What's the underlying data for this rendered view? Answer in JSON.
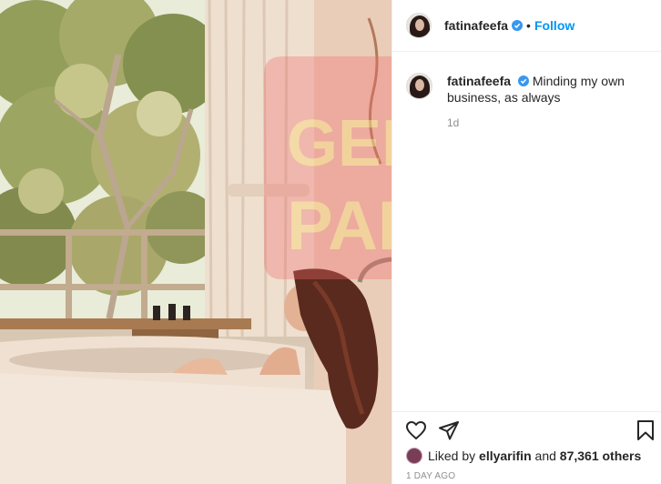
{
  "post": {
    "username": "fatinafeefa",
    "separator": "•",
    "follow_label": "Follow"
  },
  "caption": {
    "username": "fatinafeefa",
    "text": "Minding my own business, as always",
    "time": "1d"
  },
  "likes": {
    "prefix": "Liked by",
    "user": "ellyarifin",
    "connector": "and",
    "others": "87,361 others"
  },
  "date": "1 DAY AGO",
  "watermark": {
    "line1": "GEM",
    "line2": "PAK"
  },
  "colors": {
    "link": "#0095f6",
    "verified": "#3897f0",
    "watermark_red": "#f26b6b",
    "watermark_yellow": "#f8e08a"
  },
  "icons": [
    "verified-badge-icon",
    "heart-icon",
    "share-icon",
    "bookmark-icon"
  ]
}
